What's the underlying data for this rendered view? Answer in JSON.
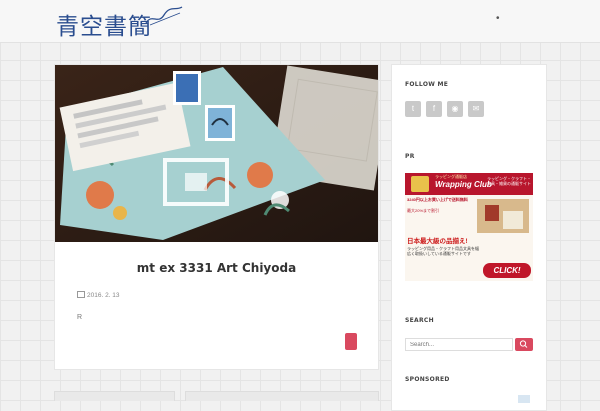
{
  "site": {
    "logo_text": "青空書簡"
  },
  "post": {
    "title": "mt ex 3331 Art Chiyoda",
    "date": "2016. 2. 13",
    "excerpt": "R"
  },
  "sidebar": {
    "follow_title": "FOLLOW ME",
    "social": [
      {
        "icon": "twitter-icon",
        "glyph": "t"
      },
      {
        "icon": "facebook-icon",
        "glyph": "f"
      },
      {
        "icon": "rss-icon",
        "glyph": "◉"
      },
      {
        "icon": "mail-icon",
        "glyph": "✉"
      }
    ],
    "pr_title": "PR",
    "ad": {
      "tag": "ラッピング通販店",
      "brand": "Wrapping Club",
      "headline": "ラッピング・クラフト・文具・雑貨の通販サイト",
      "promo1": "3240円以上お買い上げで送料無料",
      "promo2": "最大20%まで割引",
      "highlight": "日本最大級の品揃え!",
      "desc": "ラッピング用品・クラフト用品文具を幅広く取扱いしている通販サイトです",
      "cta": "CLICK!"
    },
    "search_title": "SEARCH",
    "search_placeholder": "Search...",
    "sponsored_title": "SPONSORED"
  },
  "colors": {
    "accent": "#d9495f",
    "logo": "#2a4d8f"
  }
}
